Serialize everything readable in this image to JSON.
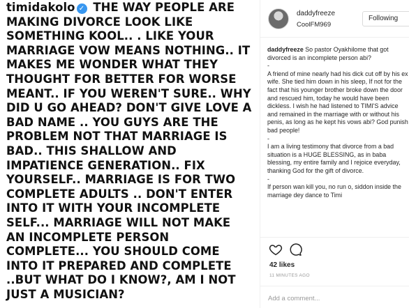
{
  "caption": {
    "username": "timidakolo",
    "verified_icon": "verified-badge-icon",
    "text": "THE WAY PEOPLE ARE MAKING DIVORCE LOOK LIKE SOMETHING  KOOL.. . LIKE YOUR MARRIAGE  VOW MEANS NOTHING.. IT MAKES ME WONDER WHAT THEY THOUGHT FOR BETTER FOR WORSE MEANT.. IF YOU WEREN'T SURE.. WHY DID U GO AHEAD? DON'T GIVE LOVE A BAD NAME .. YOU GUYS ARE THE PROBLEM NOT THAT MARRIAGE IS BAD.. THIS SHALLOW AND IMPATIENCE GENERATION.. FIX YOURSELF.. MARRIAGE IS FOR TWO COMPLETE ADULTS .. DON'T ENTER INTO IT WITH YOUR INCOMPLETE SELF... MARRIAGE WILL NOT MAKE AN INCOMPLETE PERSON COMPLETE... YOU SHOULD COME INTO  IT PREPARED AND COMPLETE ..BUT WHAT DO I KNOW?, AM  I  NOT JUST A MUSICIAN?"
  },
  "post": {
    "header": {
      "username": "daddyfreeze",
      "location": "CoolFM969",
      "follow_label": "Following"
    },
    "comment": {
      "author": "daddyfreeze",
      "paragraphs": [
        "So pastor Oyakhilome that got divorced is an incomplete person abi?",
        "-",
        "A friend of mine nearly had his dick cut off by his ex wife. She tied him down in his sleep, If not for the fact that his younger brother broke down the door and rescued him, today he would have been dickless. I wish he had listened to TIMI'S advice and remained in the marriage with or without his penis, as long as he kept his vows abi? God punish bad people!",
        "-",
        "I am a living testimony that divorce from a bad situation is a HUGE BLESSING, as in baba blessing, my entire family and I rejoice everyday, thanking God for the gift of divorce.",
        "-",
        "If person wan kill you, no run o, siddon inside the marriage dey dance to Timi"
      ]
    },
    "actions": {
      "like_icon": "heart-icon",
      "comment_icon": "comment-icon"
    },
    "likes": "42 likes",
    "timestamp": "11 MINUTES AGO",
    "add_comment_placeholder": "Add a comment..."
  },
  "colors": {
    "verified": "#3897f0",
    "border": "#efefef",
    "muted": "#999999",
    "text": "#262626"
  }
}
